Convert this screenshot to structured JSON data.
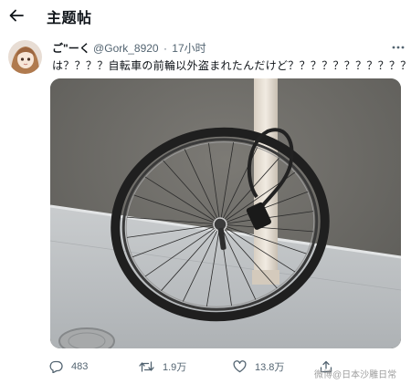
{
  "header": {
    "title": "主题帖"
  },
  "tweet": {
    "display_name": "ご\"ーく",
    "handle": "@Gork_8920",
    "separator": "·",
    "time": "17小时",
    "text": "は？？？？自転車の前輪以外盗まれたんだけど？？？？？？？？？？？？"
  },
  "actions": {
    "reply_count": "483",
    "retweet_count": "1.9万",
    "like_count": "13.8万"
  },
  "watermark": "微博@日本沙雕日常",
  "icons": {
    "back": "arrow-left-icon",
    "more": "more-horizontal-icon",
    "reply": "reply-icon",
    "retweet": "retweet-icon",
    "like": "heart-icon",
    "share": "share-icon"
  }
}
